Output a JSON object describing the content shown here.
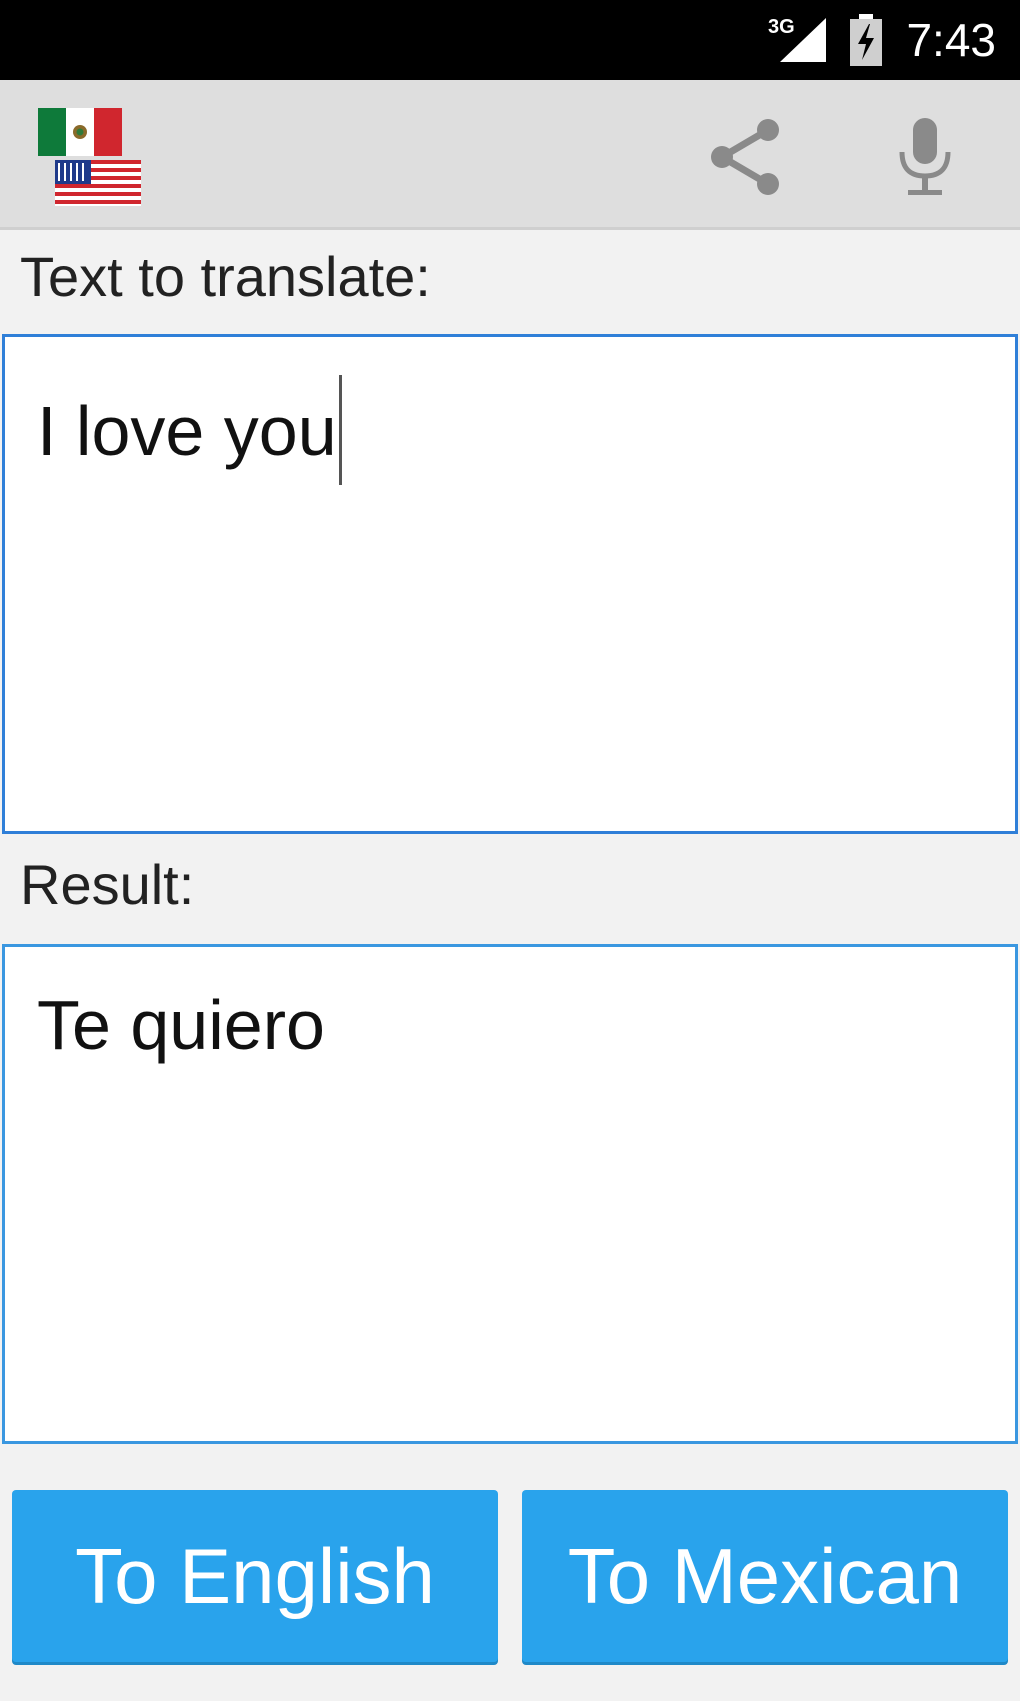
{
  "status_bar": {
    "network": "3G",
    "time": "7:43",
    "icons": [
      "signal-icon",
      "battery-charging-icon"
    ]
  },
  "action_bar": {
    "logo": "mexico-usa-flags-logo",
    "actions": [
      {
        "icon": "share-icon"
      },
      {
        "icon": "microphone-icon"
      }
    ]
  },
  "input": {
    "label": "Text to translate:",
    "value": "I love you"
  },
  "result": {
    "label": "Result:",
    "value": "Te quiero"
  },
  "buttons": {
    "to_english": "To English",
    "to_mexican": "To Mexican"
  },
  "colors": {
    "accent": "#29a3ec",
    "field_border": "#2f7fd8",
    "action_bar": "#dedede",
    "status_bar": "#000000"
  }
}
